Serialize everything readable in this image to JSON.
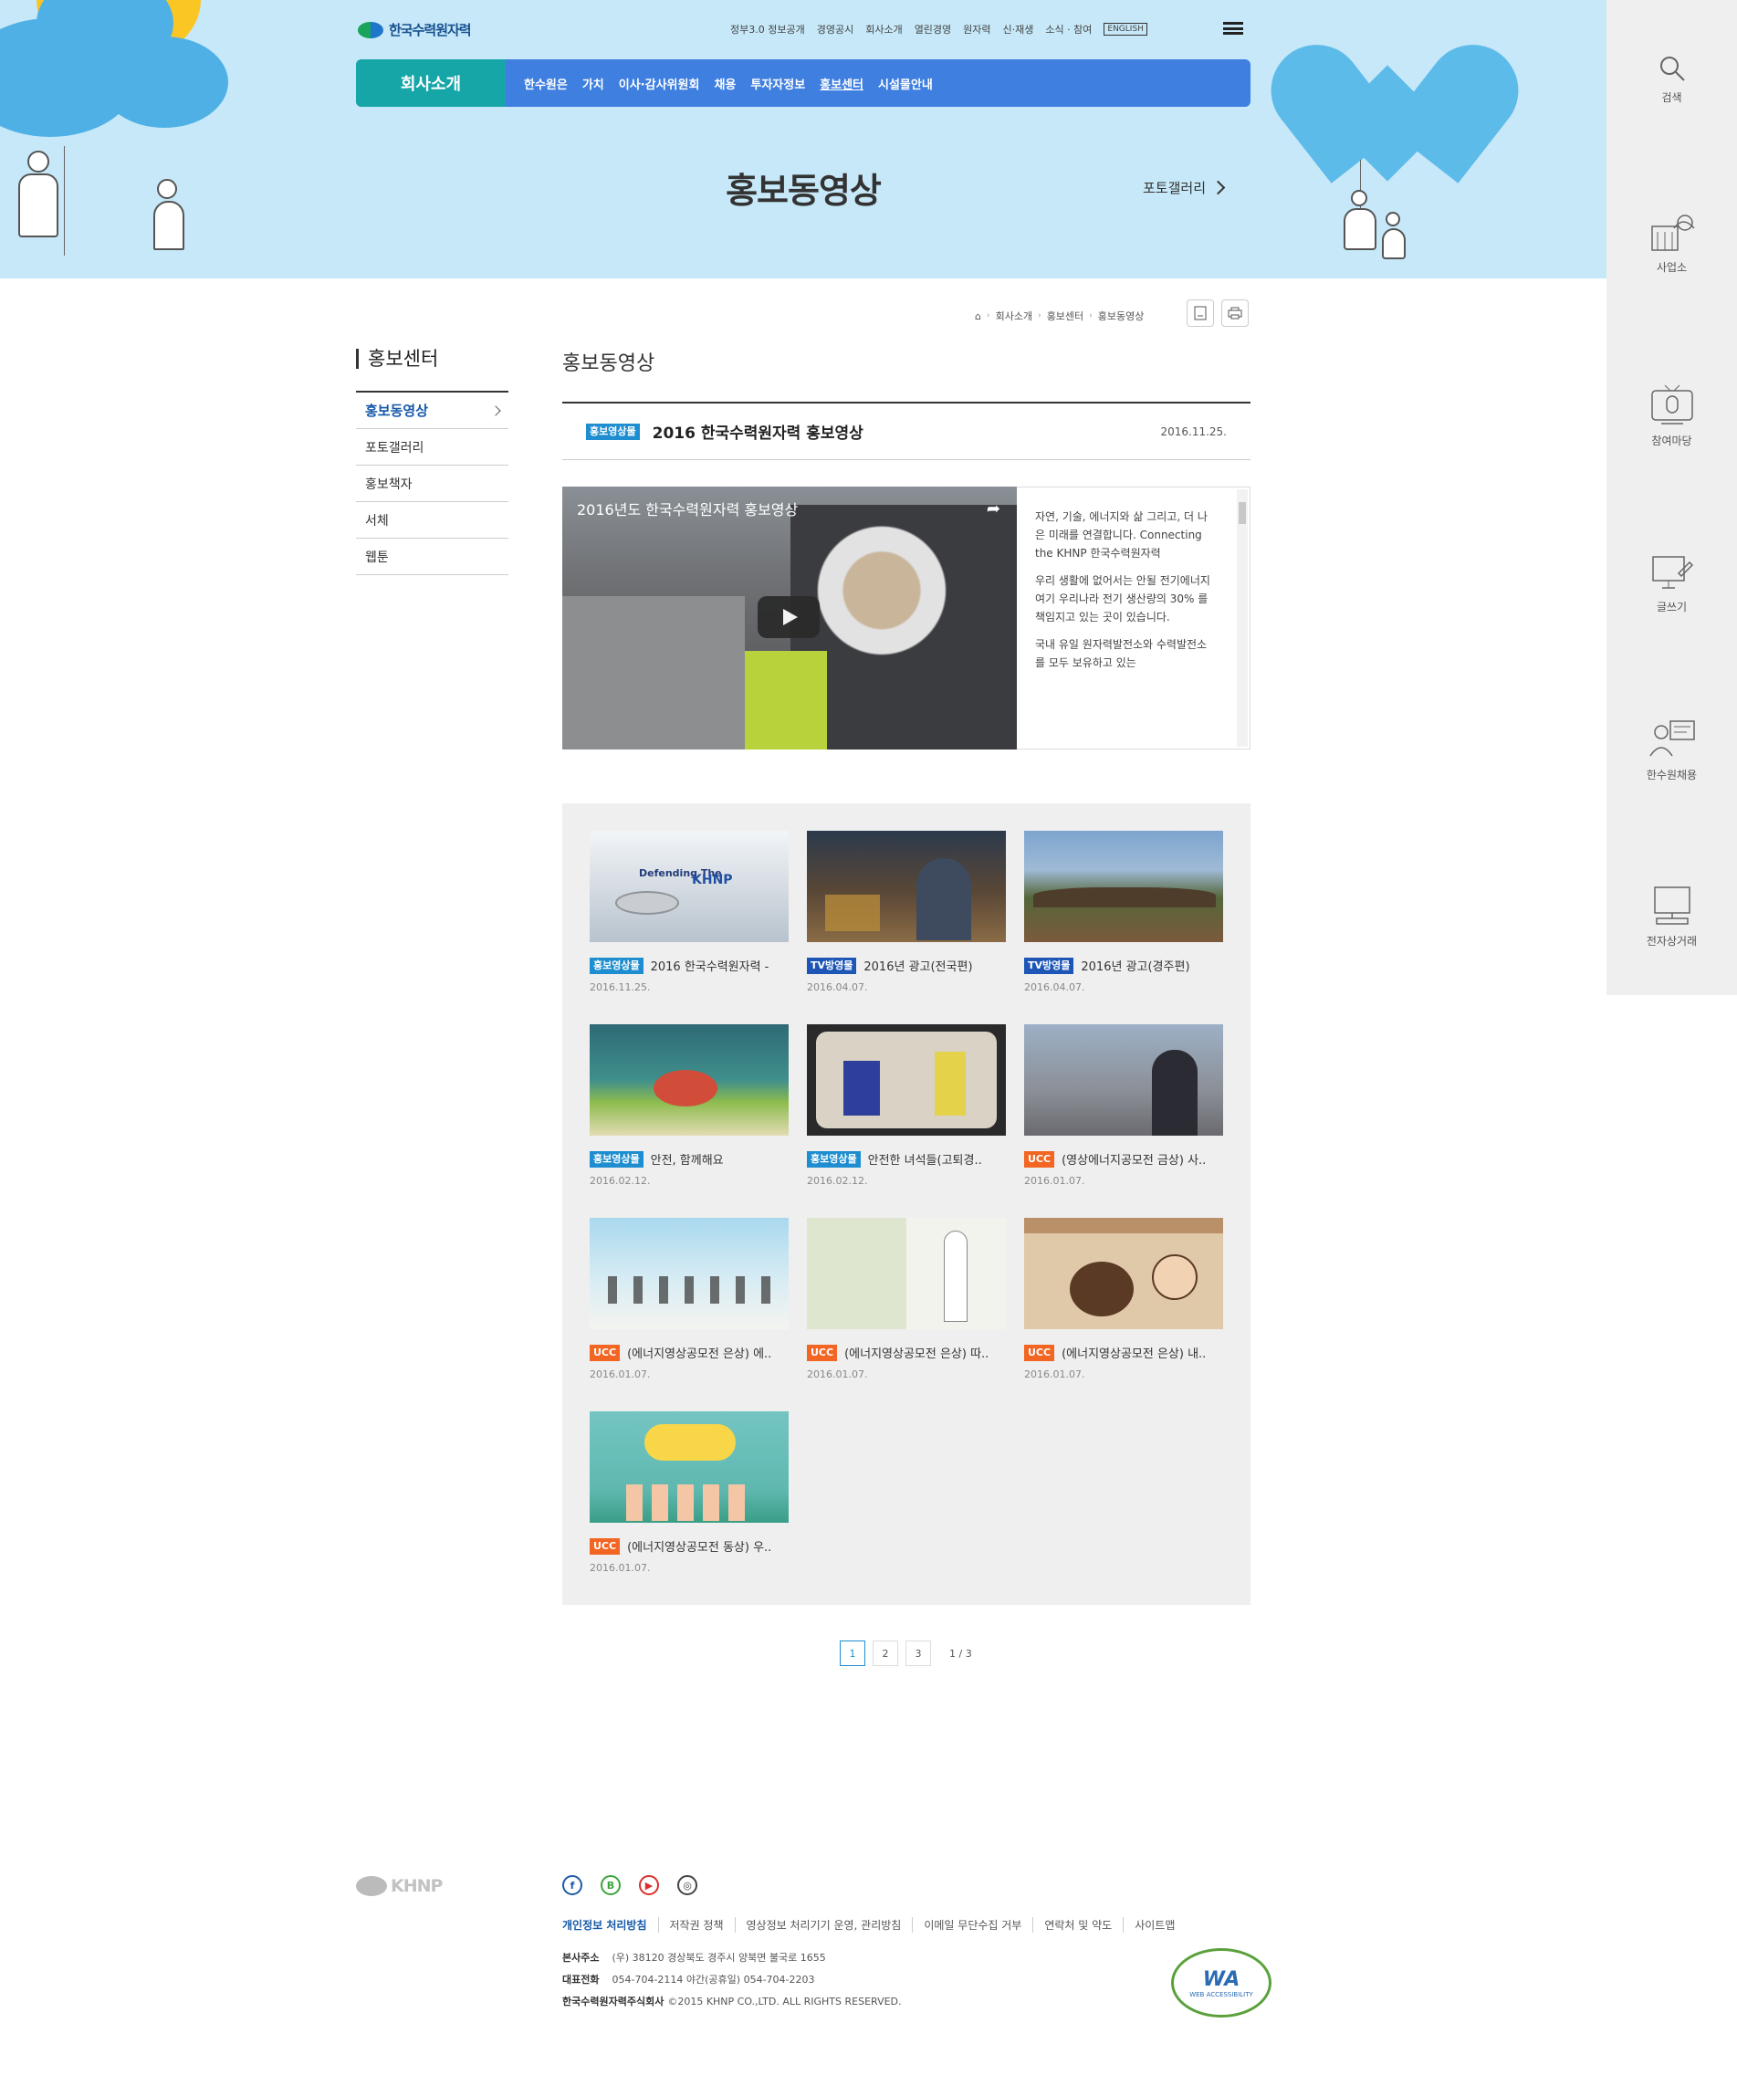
{
  "header": {
    "logo_text": "한국수력원자력",
    "util_links": [
      "정부3.0 정보공개",
      "경영공시",
      "회사소개",
      "열린경영",
      "원자력",
      "신·재생",
      "소식 · 참여"
    ],
    "english_label": "ENGLISH",
    "gnb_title": "회사소개",
    "gnb_items": [
      "한수원은",
      "가치",
      "이사·감사위원회",
      "채용",
      "투자자정보",
      "홍보센터",
      "시설물안내"
    ],
    "page_title": "홍보동영상",
    "hero_link": "포토갤러리"
  },
  "quick": [
    {
      "label": "검색",
      "icon": "search-icon"
    },
    {
      "label": "사업소",
      "icon": "plant-icon"
    },
    {
      "label": "참여마당",
      "icon": "tv-icon"
    },
    {
      "label": "글쓰기",
      "icon": "write-icon"
    },
    {
      "label": "한수원채용",
      "icon": "recruit-icon"
    },
    {
      "label": "전자상거래",
      "icon": "computer-icon"
    }
  ],
  "breadcrumb": [
    "회사소개",
    "홍보센터",
    "홍보동영상"
  ],
  "sidebar": {
    "title": "홍보센터",
    "items": [
      "홍보동영상",
      "포토갤러리",
      "홍보책자",
      "서체",
      "웹툰"
    ]
  },
  "content": {
    "title": "홍보동영상",
    "article": {
      "tag": "홍보영상물",
      "title": "2016 한국수력원자력 홍보영상",
      "date": "2016.11.25."
    },
    "player_title": "2016년도 한국수력원자력 홍보영상",
    "description": [
      "자연, 기술, 에너지와 삶 그리고, 더 나은 미래를 연결합니다. Connecting the KHNP 한국수력원자력",
      "우리 생활에 없어서는 안될 전기에너지 여기 우리나라 전기 생산량의 30% 를 책임지고 있는 곳이 있습니다.",
      "국내 유일 원자력발전소와 수력발전소를 모두 보유하고 있는"
    ]
  },
  "gallery": [
    {
      "tag": "홍보영상물",
      "tag_type": "blue",
      "title": "2016 한국수력원자력 -",
      "date": "2016.11.25.",
      "thumb": "defending"
    },
    {
      "tag": "TV방영물",
      "tag_type": "tv",
      "title": "2016년 광고(전국편)",
      "date": "2016.04.07.",
      "thumb": "night-market"
    },
    {
      "tag": "TV방영물",
      "tag_type": "tv",
      "title": "2016년 광고(경주편)",
      "date": "2016.04.07.",
      "thumb": "village"
    },
    {
      "tag": "홍보영상물",
      "tag_type": "blue",
      "title": "안전, 함께해요",
      "date": "2016.02.12.",
      "thumb": "cartoon-hills"
    },
    {
      "tag": "홍보영상물",
      "tag_type": "blue",
      "title": "안전한 녀석들(고퇴경..",
      "date": "2016.02.12.",
      "thumb": "safety-show"
    },
    {
      "tag": "UCC",
      "tag_type": "ucc",
      "title": "(영상에너지공모전 금상) 사..",
      "date": "2016.01.07.",
      "thumb": "girl-city"
    },
    {
      "tag": "UCC",
      "tag_type": "ucc",
      "title": "(에너지영상공모전 은상) 에..",
      "date": "2016.01.07.",
      "thumb": "kids-run"
    },
    {
      "tag": "UCC",
      "tag_type": "ucc",
      "title": "(에너지영상공모전 은상) 따..",
      "date": "2016.01.07.",
      "thumb": "sketch"
    },
    {
      "tag": "UCC",
      "tag_type": "ucc",
      "title": "(에너지영상공모전 은상) 내..",
      "date": "2016.01.07.",
      "thumb": "classroom"
    },
    {
      "tag": "UCC",
      "tag_type": "ucc",
      "title": "(에너지영상공모전 동상) 우..",
      "date": "2016.01.07.",
      "thumb": "chefs"
    }
  ],
  "pagination": {
    "pages": [
      "1",
      "2",
      "3"
    ],
    "current": "1",
    "info": "1 / 3"
  },
  "footer": {
    "logo_text": "KHNP",
    "social": [
      "f",
      "B",
      "▶",
      "◎"
    ],
    "links": [
      "개인정보 처리방침",
      "저작권 정책",
      "영상정보 처리기기 운영, 관리방침",
      "이메일 무단수집 거부",
      "연락처 및 약도",
      "사이트맵"
    ],
    "address_label": "본사주소",
    "address": "(우) 38120 경상북도 경주시 양북면 불국로 1655",
    "phone_label": "대표전화",
    "phone": "054-704-2114 야간(공휴일) 054-704-2203",
    "company_label": "한국수력원자력주식회사",
    "copyright": "©2015 KHNP CO.,LTD. ALL RIGHTS RESERVED.",
    "wa_mark": "WA",
    "wa_text": "WEB ACCESSIBILITY"
  },
  "colors": {
    "accent": "#3f7fe0",
    "teal": "#16a6a8",
    "hero_bg": "#c6e8f8",
    "ucc": "#f26522",
    "tv": "#1d56b6",
    "tag": "#1f8ed0"
  }
}
